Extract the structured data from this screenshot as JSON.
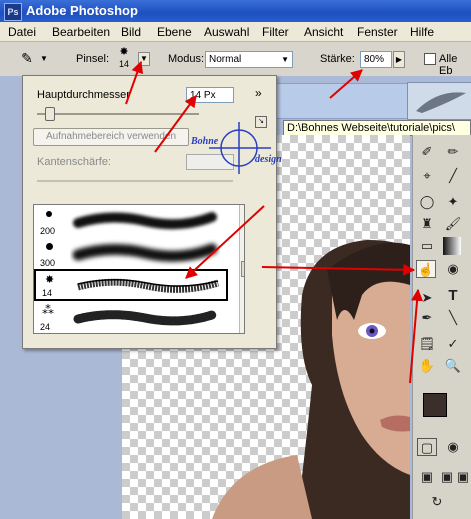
{
  "app": {
    "title": "Adobe Photoshop",
    "logo_text": "Ps"
  },
  "menu": [
    "Datei",
    "Bearbeiten",
    "Bild",
    "Ebene",
    "Auswahl",
    "Filter",
    "Ansicht",
    "Fenster",
    "Hilfe"
  ],
  "options_bar": {
    "pinsel_label": "Pinsel:",
    "brush_size": "14",
    "modus_label": "Modus:",
    "modus_value": "Normal",
    "staerke_label": "Stärke:",
    "staerke_value": "80%",
    "alle_label": "Alle Eb"
  },
  "doc_tab": {
    "text": "8)"
  },
  "tooltip": "D:\\Bohnes Webseite\\tutoriale\\pics\\",
  "popup": {
    "diameter_label": "Hauptdurchmesser",
    "diameter_value": "14 Px",
    "sample_button": "Aufnahmebereich verwenden",
    "hardness_label": "Kantenschärfe:",
    "watermark_top": "Bohne",
    "watermark_bottom": "design",
    "brushes": [
      {
        "size": "200"
      },
      {
        "size": "300"
      },
      {
        "size": "14",
        "selected": true
      },
      {
        "size": "24"
      }
    ]
  },
  "toolbox": {
    "icons": [
      "healing-brush",
      "pencil",
      "crop",
      "slice",
      "lasso-pen",
      "magic-wand",
      "stamp",
      "brush",
      "eraser",
      "gradient",
      "smudge",
      "dodge",
      "selection",
      "text",
      "pen",
      "line",
      "notes",
      "eyedropper",
      "hand",
      "zoom"
    ]
  },
  "colors": {
    "accent": "#e00000",
    "titlebar": "#1d4fbf"
  }
}
